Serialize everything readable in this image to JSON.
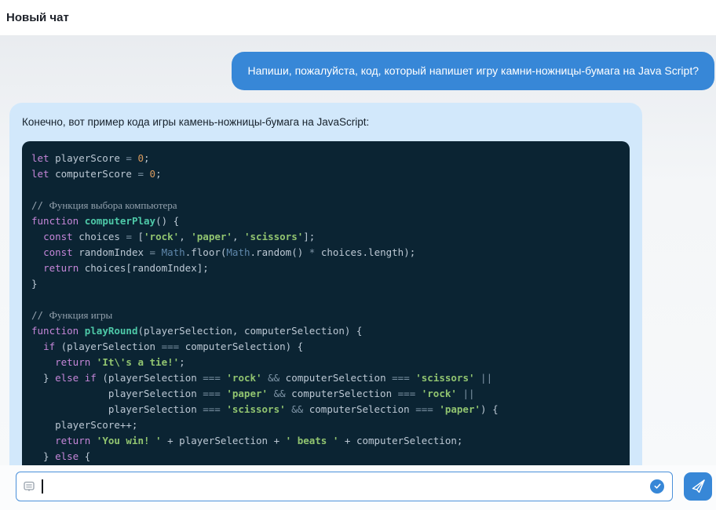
{
  "header": {
    "title": "Новый чат"
  },
  "user_message": {
    "text": "Напиши, пожалуйста, код, который напишет игру камни-ножницы-бумага на Java Script?"
  },
  "assistant_message": {
    "intro": "Конечно, вот пример кода игры камень-ножницы-бумага на JavaScript:",
    "code": {
      "language": "javascript",
      "lines": [
        [
          [
            "let",
            "kw"
          ],
          [
            " playerScore ",
            ""
          ],
          [
            "=",
            "op"
          ],
          [
            " ",
            ""
          ],
          [
            "0",
            "num"
          ],
          [
            ";",
            ""
          ]
        ],
        [
          [
            "let",
            "kw"
          ],
          [
            " computerScore ",
            ""
          ],
          [
            "=",
            "op"
          ],
          [
            " ",
            ""
          ],
          [
            "0",
            "num"
          ],
          [
            ";",
            ""
          ]
        ],
        [],
        [
          [
            "// ",
            "cm"
          ],
          [
            "Функция выбора компьютера",
            "cmc"
          ]
        ],
        [
          [
            "function",
            "kw"
          ],
          [
            " ",
            ""
          ],
          [
            "computerPlay",
            "fn"
          ],
          [
            "() {",
            ""
          ]
        ],
        [
          [
            "  ",
            ""
          ],
          [
            "const",
            "kw"
          ],
          [
            " choices ",
            ""
          ],
          [
            "=",
            "op"
          ],
          [
            " [",
            ""
          ],
          [
            "'rock'",
            "str"
          ],
          [
            ", ",
            ""
          ],
          [
            "'paper'",
            "str"
          ],
          [
            ", ",
            ""
          ],
          [
            "'scissors'",
            "str"
          ],
          [
            "];",
            ""
          ]
        ],
        [
          [
            "  ",
            ""
          ],
          [
            "const",
            "kw"
          ],
          [
            " randomIndex ",
            ""
          ],
          [
            "=",
            "op"
          ],
          [
            " ",
            ""
          ],
          [
            "Math",
            "cls"
          ],
          [
            ".floor(",
            ""
          ],
          [
            "Math",
            "cls"
          ],
          [
            ".random() ",
            ""
          ],
          [
            "*",
            "op"
          ],
          [
            " choices.length);",
            ""
          ]
        ],
        [
          [
            "  ",
            ""
          ],
          [
            "return",
            "kw"
          ],
          [
            " choices[randomIndex];",
            ""
          ]
        ],
        [
          [
            "}",
            ""
          ]
        ],
        [],
        [
          [
            "// ",
            "cm"
          ],
          [
            "Функция игры",
            "cmc"
          ]
        ],
        [
          [
            "function",
            "kw"
          ],
          [
            " ",
            ""
          ],
          [
            "playRound",
            "fn"
          ],
          [
            "(playerSelection, computerSelection) {",
            ""
          ]
        ],
        [
          [
            "  ",
            ""
          ],
          [
            "if",
            "kw"
          ],
          [
            " (playerSelection ",
            ""
          ],
          [
            "===",
            "op"
          ],
          [
            " computerSelection) {",
            ""
          ]
        ],
        [
          [
            "    ",
            ""
          ],
          [
            "return",
            "kw"
          ],
          [
            " ",
            ""
          ],
          [
            "'It\\'s a tie!'",
            "str"
          ],
          [
            ";",
            ""
          ]
        ],
        [
          [
            "  } ",
            ""
          ],
          [
            "else",
            "kw"
          ],
          [
            " ",
            ""
          ],
          [
            "if",
            "kw"
          ],
          [
            " (playerSelection ",
            ""
          ],
          [
            "===",
            "op"
          ],
          [
            " ",
            ""
          ],
          [
            "'rock'",
            "str"
          ],
          [
            " ",
            ""
          ],
          [
            "&&",
            "op"
          ],
          [
            " computerSelection ",
            ""
          ],
          [
            "===",
            "op"
          ],
          [
            " ",
            ""
          ],
          [
            "'scissors'",
            "str"
          ],
          [
            " ",
            ""
          ],
          [
            "||",
            "op"
          ]
        ],
        [
          [
            "             playerSelection ",
            ""
          ],
          [
            "===",
            "op"
          ],
          [
            " ",
            ""
          ],
          [
            "'paper'",
            "str"
          ],
          [
            " ",
            ""
          ],
          [
            "&&",
            "op"
          ],
          [
            " computerSelection ",
            ""
          ],
          [
            "===",
            "op"
          ],
          [
            " ",
            ""
          ],
          [
            "'rock'",
            "str"
          ],
          [
            " ",
            ""
          ],
          [
            "||",
            "op"
          ]
        ],
        [
          [
            "             playerSelection ",
            ""
          ],
          [
            "===",
            "op"
          ],
          [
            " ",
            ""
          ],
          [
            "'scissors'",
            "str"
          ],
          [
            " ",
            ""
          ],
          [
            "&&",
            "op"
          ],
          [
            " computerSelection ",
            ""
          ],
          [
            "===",
            "op"
          ],
          [
            " ",
            ""
          ],
          [
            "'paper'",
            "str"
          ],
          [
            ") {",
            ""
          ]
        ],
        [
          [
            "    playerScore++;",
            ""
          ]
        ],
        [
          [
            "    ",
            ""
          ],
          [
            "return",
            "kw"
          ],
          [
            " ",
            ""
          ],
          [
            "'You win! '",
            "str"
          ],
          [
            " + playerSelection + ",
            ""
          ],
          [
            "' beats '",
            "str"
          ],
          [
            " + computerSelection;",
            ""
          ]
        ],
        [
          [
            "  } ",
            ""
          ],
          [
            "else",
            "kw"
          ],
          [
            " {",
            ""
          ]
        ]
      ]
    }
  },
  "composer": {
    "input_value": "",
    "icons": [
      "message-icon",
      "check-icon",
      "send-icon"
    ]
  },
  "colors": {
    "accent_blue": "#3787d7",
    "user_bubble": "#3787d7",
    "assistant_bubble": "#d2e8fb",
    "code_background": "#0b2433",
    "input_border": "#4a90da"
  }
}
